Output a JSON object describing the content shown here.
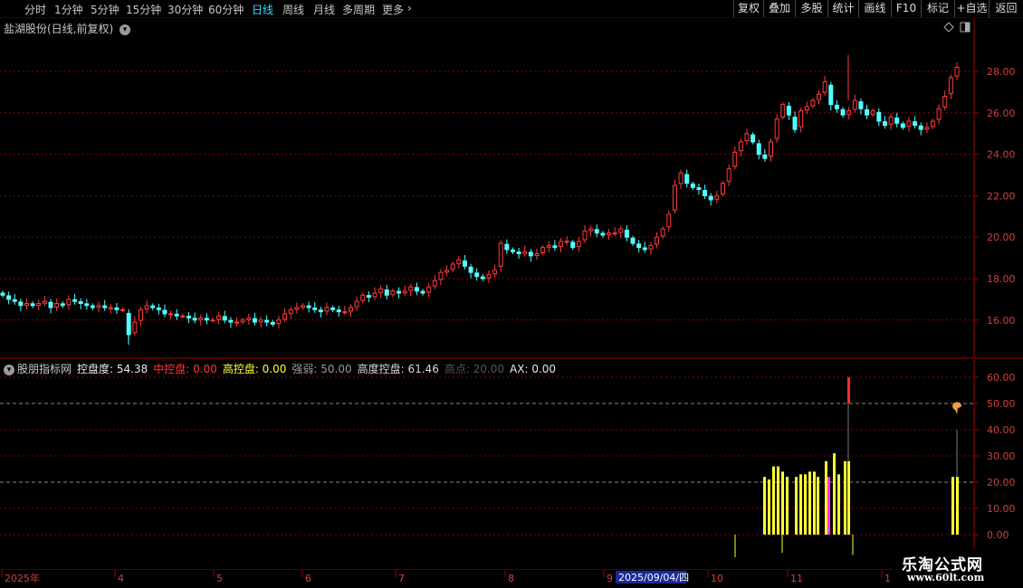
{
  "toolbar": {
    "periods": [
      {
        "label": "分时",
        "active": false
      },
      {
        "label": "1分钟",
        "active": false
      },
      {
        "label": "5分钟",
        "active": false
      },
      {
        "label": "15分钟",
        "active": false
      },
      {
        "label": "30分钟",
        "active": false
      },
      {
        "label": "60分钟",
        "active": false
      },
      {
        "label": "日线",
        "active": true
      },
      {
        "label": "周线",
        "active": false
      },
      {
        "label": "月线",
        "active": false
      },
      {
        "label": "多周期",
        "active": false
      },
      {
        "label": "更多",
        "active": false
      }
    ],
    "right_buttons": [
      "复权",
      "叠加",
      "多股",
      "统计",
      "画线",
      "F10",
      "标记",
      "+自选",
      "返回"
    ]
  },
  "price_panel": {
    "title": "盐湖股份(日线,前复权)",
    "y_ticks": [
      "28.00",
      "26.00",
      "24.00",
      "22.00",
      "20.00",
      "18.00",
      "16.00"
    ]
  },
  "indicator_panel": {
    "name": "股朋指标网",
    "items": [
      {
        "label": "控盘度: ",
        "value": "54.38",
        "color": "#e8e8e8"
      },
      {
        "label": "中控盘: ",
        "value": "0.00",
        "color": "#ff3333"
      },
      {
        "label": "高控盘: ",
        "value": "0.00",
        "color": "#ffff33"
      },
      {
        "label": "强弱: ",
        "value": "50.00",
        "color": "#9a9a9a"
      },
      {
        "label": "高度控盘: ",
        "value": "61.46",
        "color": "#d8d8d8"
      },
      {
        "label": "高点: ",
        "value": "20.00",
        "color": "#555555"
      },
      {
        "label": "AX: ",
        "value": "0.00",
        "color": "#e8e8e8"
      }
    ],
    "y_ticks": [
      "60.00",
      "50.00",
      "40.00",
      "30.00",
      "20.00",
      "10.00",
      "0.00"
    ]
  },
  "x_axis": {
    "labels": [
      "2025年",
      "4",
      "5",
      "6",
      "7",
      "8",
      "9",
      "10",
      "11",
      "1"
    ],
    "cursor_date": "2025/09/04/四"
  },
  "watermark": {
    "title": "乐淘公式网",
    "url": "www.60lt.com"
  },
  "colors": {
    "up": "#ff3c3c",
    "down": "#54ffff",
    "grid": "#8a0000",
    "bar_yellow": "#ffff33",
    "bar_magenta": "#ff33ff"
  },
  "chart_data": {
    "type": "candlestick",
    "price_series": [
      17.2,
      17.0,
      16.9,
      16.7,
      16.8,
      16.7,
      16.8,
      16.9,
      16.6,
      16.8,
      16.7,
      17.0,
      16.9,
      16.8,
      16.7,
      16.6,
      16.7,
      16.6,
      16.6,
      16.5,
      16.5,
      15.3,
      15.9,
      16.5,
      16.7,
      16.6,
      16.5,
      16.3,
      16.3,
      16.2,
      16.2,
      16.1,
      16.0,
      16.1,
      16.0,
      16.0,
      16.2,
      16.0,
      15.9,
      15.9,
      16.0,
      16.1,
      15.9,
      16.0,
      15.9,
      15.8,
      16.0,
      16.3,
      16.5,
      16.6,
      16.7,
      16.6,
      16.5,
      16.4,
      16.6,
      16.5,
      16.4,
      16.4,
      16.6,
      16.9,
      17.2,
      17.1,
      17.3,
      17.5,
      17.2,
      17.4,
      17.3,
      17.4,
      17.6,
      17.4,
      17.3,
      17.6,
      17.9,
      18.3,
      18.4,
      18.7,
      18.9,
      18.6,
      18.3,
      18.1,
      18.0,
      18.2,
      18.4,
      19.7,
      19.4,
      19.3,
      19.2,
      19.3,
      19.1,
      19.2,
      19.5,
      19.6,
      19.5,
      19.8,
      19.8,
      19.5,
      19.8,
      20.3,
      20.4,
      20.2,
      20.1,
      20.2,
      20.2,
      20.4,
      20.0,
      19.7,
      19.5,
      19.4,
      19.6,
      20.0,
      20.4,
      21.1,
      22.5,
      23.1,
      22.6,
      22.4,
      22.3,
      22.0,
      21.8,
      22.0,
      22.6,
      23.3,
      24.1,
      24.6,
      25.0,
      24.6,
      24.0,
      23.8,
      24.6,
      25.7,
      26.4,
      25.9,
      25.2,
      26.1,
      26.3,
      26.6,
      26.9,
      27.5,
      26.4,
      26.2,
      25.9,
      26.1,
      26.6,
      26.2,
      25.9,
      26.1,
      25.6,
      25.4,
      25.8,
      25.5,
      25.3,
      25.6,
      25.4,
      25.2,
      25.3,
      25.6,
      26.2,
      26.8,
      27.7,
      28.2
    ],
    "indicator_bars": [
      {
        "x": 843,
        "value": 22,
        "color": "yellow"
      },
      {
        "x": 848,
        "value": 21,
        "color": "yellow"
      },
      {
        "x": 853,
        "value": 26,
        "color": "yellow"
      },
      {
        "x": 858,
        "value": 26,
        "color": "yellow"
      },
      {
        "x": 863,
        "value": 24,
        "color": "yellow"
      },
      {
        "x": 868,
        "value": 22,
        "color": "yellow"
      },
      {
        "x": 878,
        "value": 22,
        "color": "yellow"
      },
      {
        "x": 883,
        "value": 23,
        "color": "yellow"
      },
      {
        "x": 888,
        "value": 23,
        "color": "yellow"
      },
      {
        "x": 893,
        "value": 24,
        "color": "yellow"
      },
      {
        "x": 898,
        "value": 24,
        "color": "yellow"
      },
      {
        "x": 902,
        "value": 22,
        "color": "yellow"
      },
      {
        "x": 911,
        "value": 28,
        "color": "yellow"
      },
      {
        "x": 914,
        "value": 22,
        "color": "magenta"
      },
      {
        "x": 920,
        "value": 31,
        "color": "yellow"
      },
      {
        "x": 925,
        "value": 23,
        "color": "yellow"
      },
      {
        "x": 932,
        "value": 28,
        "color": "yellow"
      },
      {
        "x": 936,
        "value": 28,
        "color": "yellow"
      },
      {
        "x": 1051,
        "value": 22,
        "color": "yellow"
      },
      {
        "x": 1056,
        "value": 22,
        "color": "yellow"
      }
    ]
  }
}
